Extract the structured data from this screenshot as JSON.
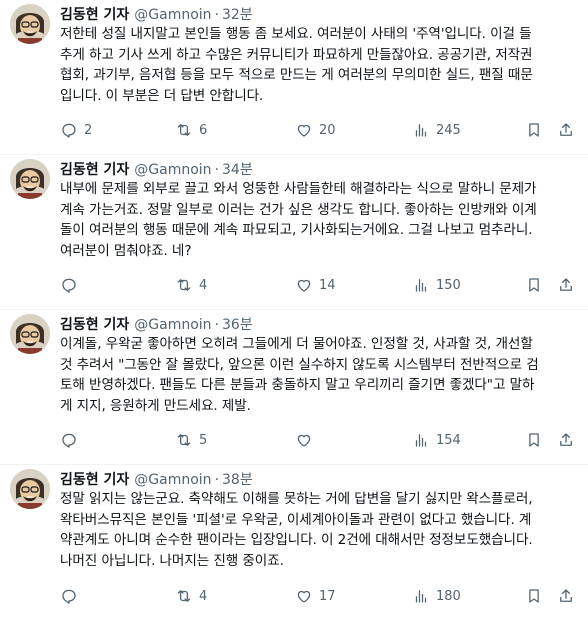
{
  "tweets": [
    {
      "name": "김동현 기자",
      "handle": "@Gamnoin",
      "dot": "·",
      "time": "32분",
      "text": "저한테 성질 내지말고 본인들 행동 좀 보세요. 여러분이 사태의 '주역'입니다. 이걸 들\n추게 하고 기사 쓰게 하고 수많은 커뮤니티가 파묘하게 만들잖아요. 공공기관, 저작권\n협회, 과기부, 음저협 등을 모두 적으로 만드는 게 여러분의 무의미한 실드, 팬질 때문\n입니다. 이 부분은 더 답변 안합니다.",
      "replies": "2",
      "retweets": "6",
      "likes": "20",
      "views": "245"
    },
    {
      "name": "김동현 기자",
      "handle": "@Gamnoin",
      "dot": "·",
      "time": "34분",
      "text": "내부에 문제를 외부로 끌고 와서 엉뚱한 사람들한테 해결하라는 식으로 말하니 문제가\n계속 가는거죠. 정말 일부로 이러는 건가 싶은 생각도 합니다. 좋아하는 인방캐와 이계\n돌이 여러분의 행동 때문에 계속 파묘되고, 기사화되는거에요. 그걸 나보고 멈추라니.\n여러분이 멈춰야죠. 네?",
      "replies": "",
      "retweets": "4",
      "likes": "14",
      "views": "150"
    },
    {
      "name": "김동현 기자",
      "handle": "@Gamnoin",
      "dot": "·",
      "time": "36분",
      "text": "이계돌, 우왁굳 좋아하면 오히려 그들에게 더 물어야죠. 인정할 것, 사과할 것, 개선할\n것 추려서 \"그동안 잘 몰랐다, 앞으론 이런 실수하지 않도록 시스템부터 전반적으로 검\n토해 반영하겠다. 팬들도 다른 분들과 충돌하지 말고 우리끼리 즐기면 좋겠다\"고 말하\n게 지지, 응원하게 만드세요. 제발.",
      "replies": "",
      "retweets": "5",
      "likes": "",
      "views": "154"
    },
    {
      "name": "김동현 기자",
      "handle": "@Gamnoin",
      "dot": "·",
      "time": "38분",
      "text": "정말 읽지는 않는군요. 축약해도 이해를 못하는 거에 답변을 달기 싫지만 왁스플로러,\n왁타버스뮤직은 본인들 '피셜'로 우왁굳, 이세계아이돌과 관련이 없다고 했습니다. 계\n약관계도 아니며 순수한 팬이라는 입장입니다. 이 2건에 대해서만 정정보도했습니다.\n나머진 아닙니다. 나머지는 진행 중이죠.",
      "replies": "",
      "retweets": "4",
      "likes": "17",
      "views": "180"
    }
  ]
}
